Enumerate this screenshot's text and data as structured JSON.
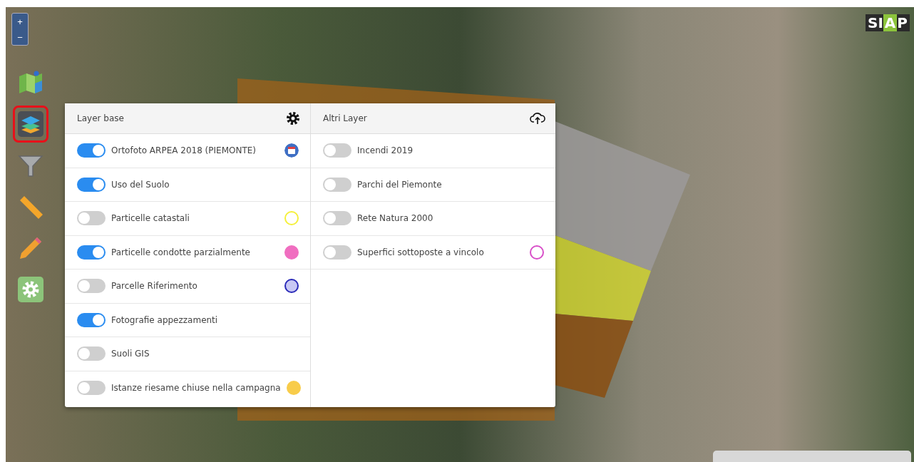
{
  "map": {
    "zoom_in": "+",
    "zoom_out": "−",
    "logo": {
      "left": "SI",
      "highlight": "A",
      "right": "P"
    }
  },
  "toolbar": [
    {
      "kind": "map",
      "selected": false
    },
    {
      "kind": "layers",
      "selected": true
    },
    {
      "kind": "filter",
      "selected": false
    },
    {
      "kind": "ruler",
      "selected": false
    },
    {
      "kind": "pencil",
      "selected": false
    },
    {
      "kind": "settings",
      "selected": false
    }
  ],
  "base_layers": {
    "title": "Layer base",
    "items": [
      {
        "label": "Ortofoto ARPEA 2018 (PIEMONTE)",
        "on": true,
        "marker": {
          "kind": "calendar",
          "color": "#3f6fc4"
        }
      },
      {
        "label": "Uso del Suolo",
        "on": true
      },
      {
        "label": "Particelle catastali",
        "on": false,
        "marker": {
          "kind": "ring",
          "color": "#f5f03c"
        }
      },
      {
        "label": "Particelle condotte parzialmente",
        "on": true,
        "marker": {
          "kind": "dot",
          "color": "#f06ec0"
        }
      },
      {
        "label": "Parcelle Riferimento",
        "on": false,
        "marker": {
          "kind": "ringfill",
          "color": "#2a2ab8"
        }
      },
      {
        "label": "Fotografie appezzamenti",
        "on": true
      },
      {
        "label": "Suoli GIS",
        "on": false
      },
      {
        "label": "Istanze riesame chiuse nella campagna",
        "on": false,
        "marker": {
          "kind": "dot",
          "color": "#f8cc4a"
        }
      }
    ]
  },
  "other_layers": {
    "title": "Altri Layer",
    "items": [
      {
        "label": "Incendi 2019",
        "on": false
      },
      {
        "label": "Parchi del Piemonte",
        "on": false
      },
      {
        "label": "Rete Natura 2000",
        "on": false
      },
      {
        "label": "Superfici sottoposte a vincolo",
        "on": false,
        "marker": {
          "kind": "ring",
          "color": "#d84fc8"
        }
      }
    ]
  }
}
